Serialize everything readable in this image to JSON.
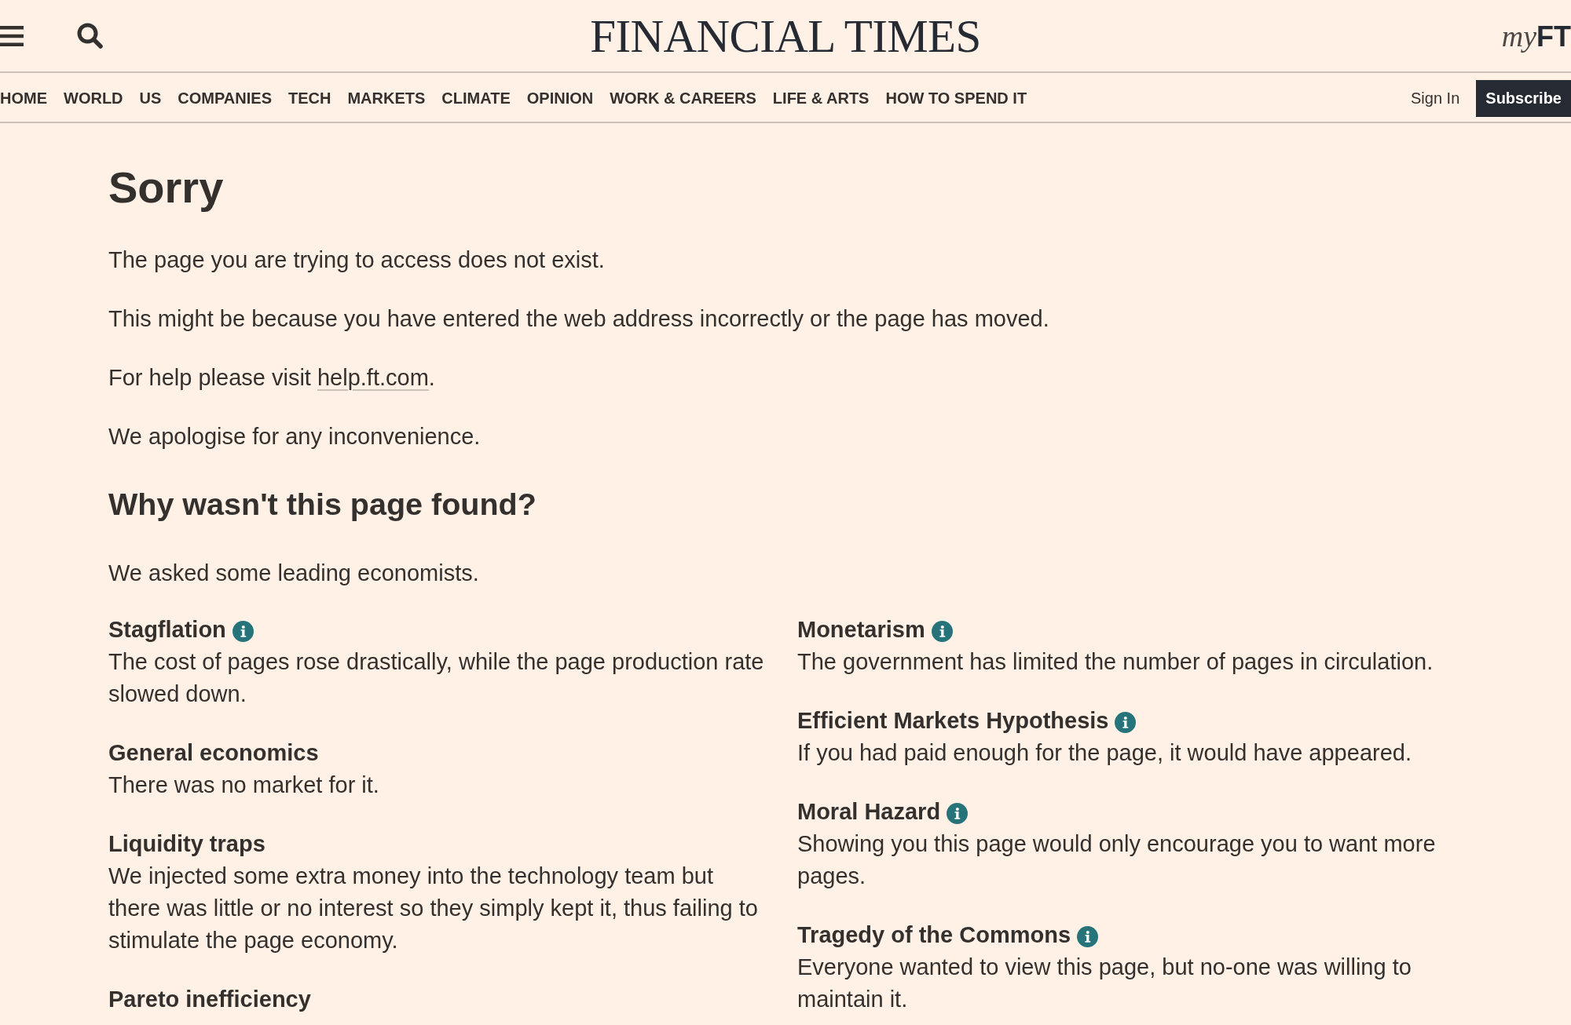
{
  "header": {
    "logo": "FINANCIAL TIMES",
    "myft_link": [
      "my",
      "FT"
    ]
  },
  "nav": {
    "items": [
      "HOME",
      "WORLD",
      "US",
      "COMPANIES",
      "TECH",
      "MARKETS",
      "CLIMATE",
      "OPINION",
      "WORK & CAREERS",
      "LIFE & ARTS",
      "HOW TO SPEND IT"
    ],
    "sign_in": "Sign In",
    "subscribe": "Subscribe"
  },
  "content": {
    "title": "Sorry",
    "paragraphs": [
      {
        "parts": [
          {
            "kind": "text",
            "text": "The page you are trying to access does not exist."
          }
        ]
      },
      {
        "parts": [
          {
            "kind": "text",
            "text": "This might be because you have entered the web address incorrectly or the page has moved."
          }
        ]
      },
      {
        "parts": [
          {
            "kind": "text",
            "text": "For help please visit "
          },
          {
            "kind": "link",
            "text": "help.ft.com"
          },
          {
            "kind": "text",
            "text": "."
          }
        ]
      },
      {
        "parts": [
          {
            "kind": "text",
            "text": "We apologise for any inconvenience."
          }
        ]
      }
    ],
    "subtitle": "Why wasn't this page found?",
    "intro": "We asked some leading economists.",
    "columns": [
      [
        {
          "title": "Stagflation",
          "info": true,
          "description": "The cost of pages rose drastically, while the page production rate slowed down."
        },
        {
          "title": "General economics",
          "info": false,
          "description": "There was no market for it."
        },
        {
          "title": "Liquidity traps",
          "info": false,
          "description": "We injected some extra money into the technology team but there was little or no interest so they simply kept it, thus failing to stimulate the page economy."
        },
        {
          "title": "Pareto inefficiency",
          "info": false
        }
      ],
      [
        {
          "title": "Monetarism",
          "info": true,
          "description": "The government has limited the number of pages in circulation."
        },
        {
          "title": "Efficient Markets Hypothesis",
          "info": true,
          "description": "If you had paid enough for the page, it would have appeared."
        },
        {
          "title": "Moral Hazard",
          "info": true,
          "description": "Showing you this page would only encourage you to want more pages."
        },
        {
          "title": "Tragedy of the Commons",
          "info": true,
          "description": "Everyone wanted to view this page, but no-one was willing to maintain it."
        }
      ]
    ]
  }
}
